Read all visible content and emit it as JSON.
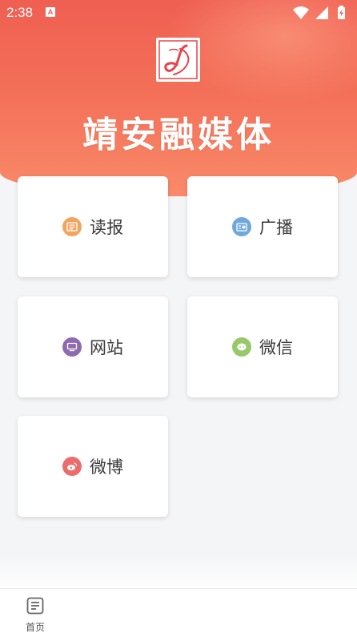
{
  "status_bar": {
    "time": "2:38",
    "notification_icon": "A",
    "icons": [
      "wifi-icon",
      "signal-icon",
      "battery-icon"
    ]
  },
  "header": {
    "logo_icon": "jingan-logo-icon",
    "brand": "靖安融媒体",
    "colors": {
      "gradient_top": "#ef5f52",
      "gradient_bottom": "#f98a6a"
    }
  },
  "grid": {
    "items": [
      {
        "label": "读报",
        "icon": "newspaper-icon",
        "color": "#f0a55e"
      },
      {
        "label": "广播",
        "icon": "radio-icon",
        "color": "#6fa8dc"
      },
      {
        "label": "网站",
        "icon": "monitor-icon",
        "color": "#8e6bb0"
      },
      {
        "label": "微信",
        "icon": "wechat-icon",
        "color": "#97c86a"
      },
      {
        "label": "微博",
        "icon": "weibo-icon",
        "color": "#ec6c6c"
      }
    ]
  },
  "tabbar": {
    "items": [
      {
        "label": "首页",
        "icon": "home-list-icon"
      }
    ]
  }
}
